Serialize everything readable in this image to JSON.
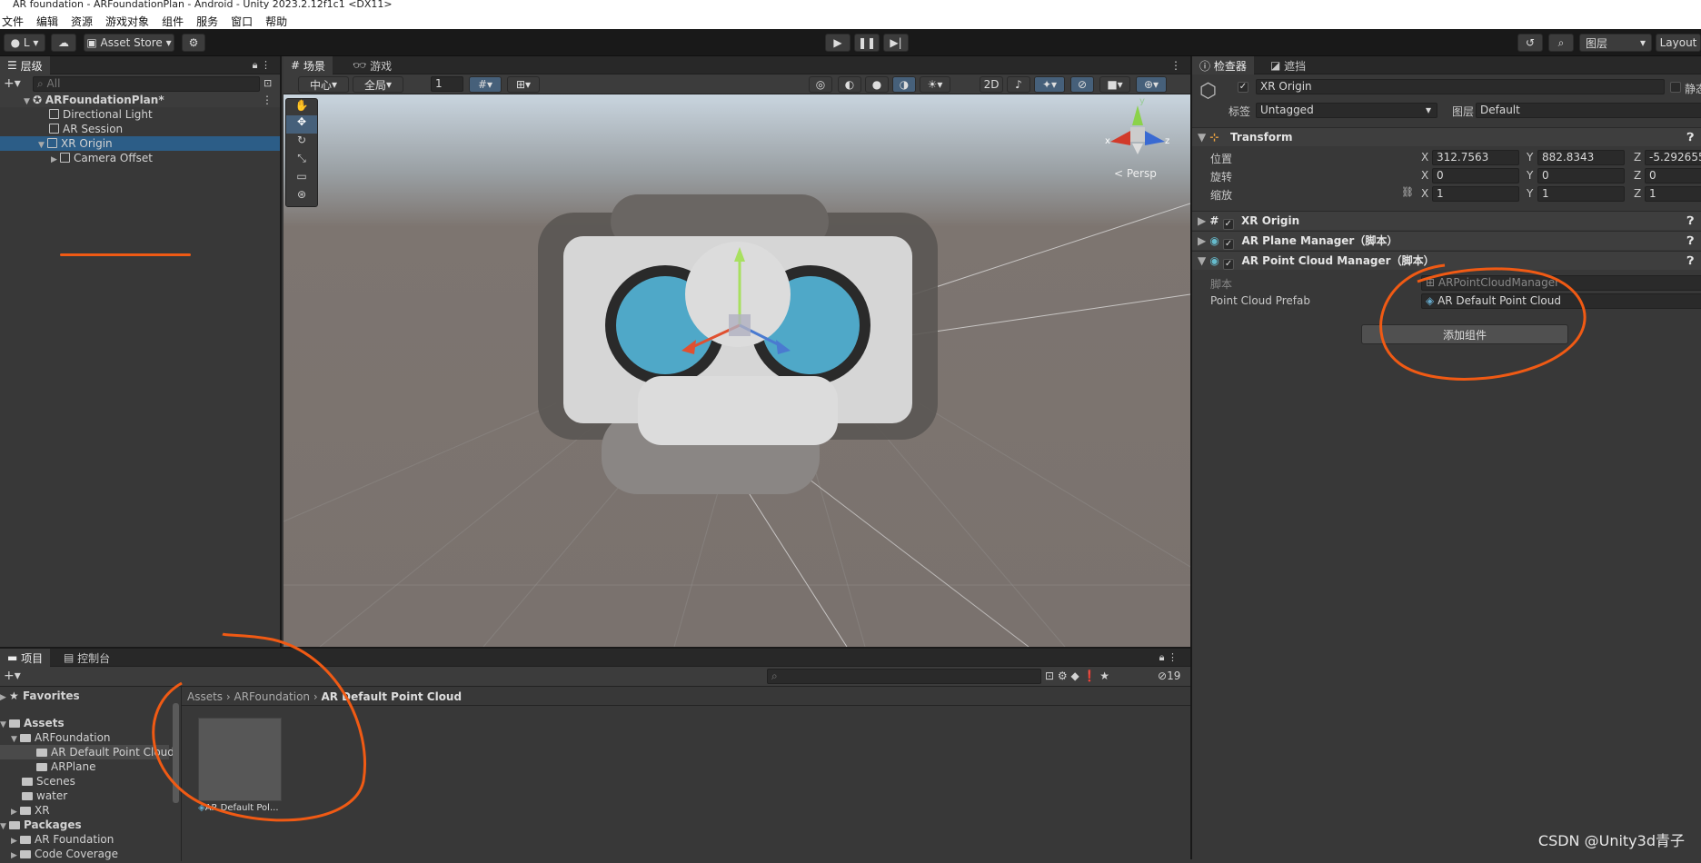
{
  "window": {
    "title": "AR foundation - ARFoundationPlan - Android - Unity 2023.2.12f1c1 <DX11>"
  },
  "menu": [
    "文件",
    "编辑",
    "资源",
    "游戏对象",
    "组件",
    "服务",
    "窗口",
    "帮助"
  ],
  "toolbar": {
    "account": "L",
    "asset_store": "Asset Store",
    "layers": "图层",
    "layout": "Layout"
  },
  "hierarchy": {
    "tab": "层级",
    "search_placeholder": "All",
    "scene": "ARFoundationPlan*",
    "items": [
      "Directional Light",
      "AR Session",
      "XR Origin",
      "Camera Offset"
    ]
  },
  "scene_view": {
    "tabs": [
      "场景",
      "游戏"
    ],
    "pivot": "中心",
    "space": "全局",
    "grid_size": "1",
    "mode_2d": "2D",
    "persp": "< Persp",
    "gizmo_axes": [
      "y",
      "x",
      "z"
    ]
  },
  "inspector": {
    "tabs": [
      "检查器",
      "遮挡"
    ],
    "object_name": "XR Origin",
    "static_label": "静态",
    "tag_label": "标签",
    "tag_value": "Untagged",
    "layer_label": "图层",
    "layer_value": "Default",
    "transform": {
      "title": "Transform",
      "position_label": "位置",
      "rotation_label": "旋转",
      "scale_label": "缩放",
      "position": [
        "312.7563",
        "882.8343",
        "-5.292655"
      ],
      "rotation": [
        "0",
        "0",
        "0"
      ],
      "scale": [
        "1",
        "1",
        "1"
      ]
    },
    "components": [
      "XR Origin",
      "AR Plane Manager（脚本）",
      "AR Point Cloud Manager（脚本）"
    ],
    "script_label": "脚本",
    "script_value": "ARPointCloudManager",
    "prefab_label": "Point Cloud Prefab",
    "prefab_value": "AR Default Point Cloud",
    "add_component": "添加组件"
  },
  "project": {
    "tabs": [
      "项目",
      "控制台"
    ],
    "favorites": "Favorites",
    "assets": "Assets",
    "tree": [
      "ARFoundation",
      "AR Default Point Cloud",
      "ARPlane",
      "Scenes",
      "water",
      "XR"
    ],
    "packages": "Packages",
    "packages_tree": [
      "AR Foundation",
      "Code Coverage"
    ],
    "breadcrumb": [
      "Assets",
      "ARFoundation",
      "AR Default Point Cloud"
    ],
    "asset_label": "AR Default Pol...",
    "hidden_count": "19"
  },
  "watermark": "CSDN @Unity3d青子",
  "colors": {
    "accent": "#2c5d87",
    "annotation": "#f05a14",
    "sky": "#c8d3dd",
    "ground": "#7c7470"
  }
}
